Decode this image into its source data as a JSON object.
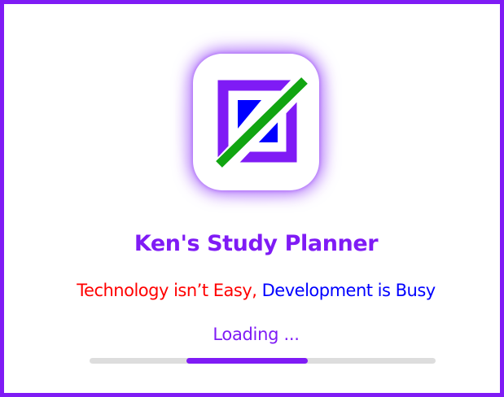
{
  "app": {
    "title": "Ken's Study Planner"
  },
  "tagline": {
    "part1": "Technology isn’t Easy,",
    "part2": "Development is Busy"
  },
  "loading": {
    "label": "Loading ...",
    "progress": {
      "start_fraction": 0.28,
      "end_fraction": 0.63
    }
  },
  "colors": {
    "brand_purple": "#7f1bf5",
    "tagline_red": "#ff0000",
    "tagline_blue": "#0000ff",
    "logo_green": "#11a511",
    "logo_blue": "#0000ff",
    "track_gray": "#dddddd"
  },
  "icons": {
    "logo": "app-logo-icon"
  }
}
